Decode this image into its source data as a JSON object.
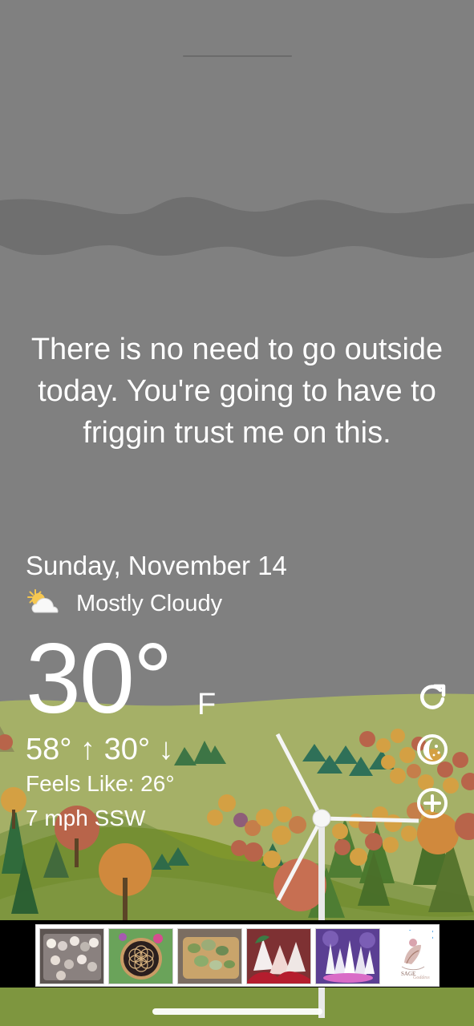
{
  "message": "There is no need to go outside today. You're going to have to friggin trust me on this.",
  "weather": {
    "date": "Sunday, November 14",
    "condition": "Mostly Cloudy",
    "temperature": "30°",
    "unit": "F",
    "high_low": "58° ↑ 30° ↓",
    "feels_like": "Feels Like: 26°",
    "wind": "7 mph SSW"
  },
  "icons": {
    "condition": "partly-cloudy-icon",
    "refresh": "refresh-icon",
    "moon": "moon-icon",
    "add": "add-icon",
    "ad_play": "ad-info-icon",
    "ad_close": "close-icon"
  },
  "colors": {
    "sky": "#808080",
    "hill_light": "#a5b067",
    "hill_mid": "#6d8b38",
    "hill_dark": "#58722e",
    "tree_orange": "#d4a043",
    "tree_red": "#b8644a",
    "tree_green": "#2f6b3c"
  }
}
